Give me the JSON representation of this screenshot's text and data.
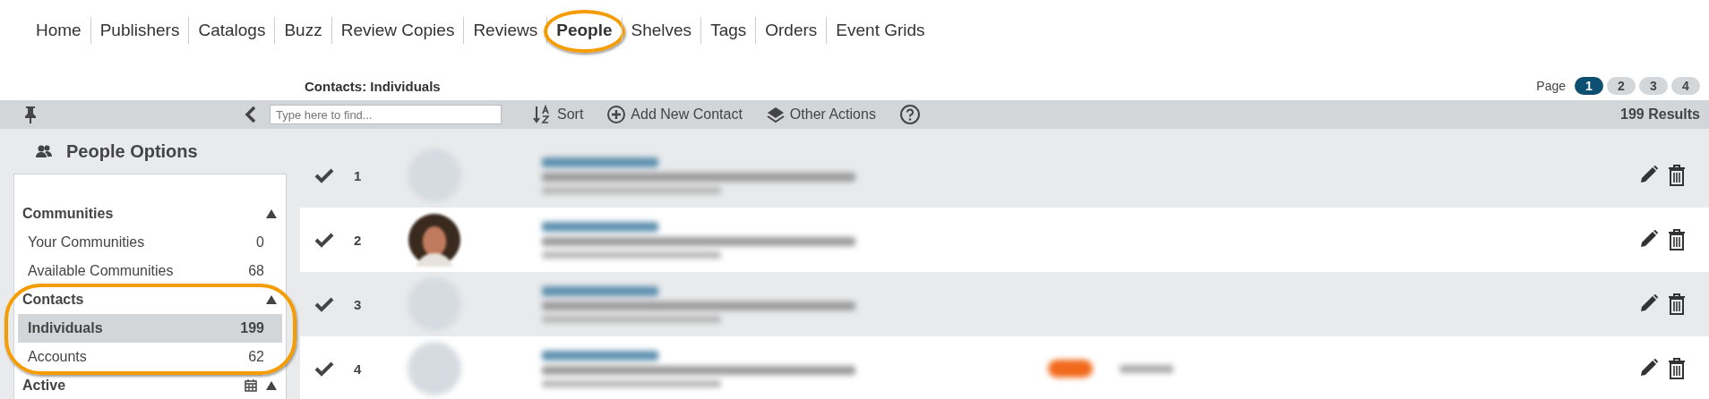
{
  "nav": [
    {
      "label": "Home",
      "selected": false,
      "highlighted": false
    },
    {
      "label": "Publishers",
      "selected": false,
      "highlighted": false
    },
    {
      "label": "Catalogs",
      "selected": false,
      "highlighted": false
    },
    {
      "label": "Buzz",
      "selected": false,
      "highlighted": false
    },
    {
      "label": "Review Copies",
      "selected": false,
      "highlighted": false
    },
    {
      "label": "Reviews",
      "selected": false,
      "highlighted": false
    },
    {
      "label": "People",
      "selected": true,
      "highlighted": true
    },
    {
      "label": "Shelves",
      "selected": false,
      "highlighted": false
    },
    {
      "label": "Tags",
      "selected": false,
      "highlighted": false
    },
    {
      "label": "Orders",
      "selected": false,
      "highlighted": false
    },
    {
      "label": "Event Grids",
      "selected": false,
      "highlighted": false
    }
  ],
  "page_title": "Contacts: Individuals",
  "pagination": {
    "label": "Page",
    "pages": [
      {
        "label": "1",
        "selected": true
      },
      {
        "label": "2",
        "selected": false
      },
      {
        "label": "3",
        "selected": false
      },
      {
        "label": "4",
        "selected": false
      }
    ]
  },
  "toolbar": {
    "search": {
      "placeholder": "Type here to find..."
    },
    "actions": [
      {
        "kind": "sort",
        "label": "Sort"
      },
      {
        "kind": "add",
        "label": "Add New Contact"
      },
      {
        "kind": "other",
        "label": "Other Actions"
      },
      {
        "kind": "help"
      }
    ],
    "results": "199 Results"
  },
  "sidebar": {
    "title": "People Options",
    "sections": [
      {
        "title": "Communities",
        "expanded": true,
        "highlighted": false,
        "calendar": false,
        "items": [
          {
            "label": "Your Communities",
            "count": "0",
            "selected": false
          },
          {
            "label": "Available Communities",
            "count": "68",
            "selected": false
          }
        ]
      },
      {
        "title": "Contacts",
        "expanded": true,
        "highlighted": true,
        "calendar": false,
        "items": [
          {
            "label": "Individuals",
            "count": "199",
            "selected": true
          },
          {
            "label": "Accounts",
            "count": "62",
            "selected": false
          }
        ]
      },
      {
        "title": "Active",
        "expanded": true,
        "highlighted": false,
        "calendar": true
      }
    ]
  },
  "rows": [
    {
      "number": "1",
      "checked": true,
      "photo": false,
      "tag": false
    },
    {
      "number": "2",
      "checked": true,
      "photo": true,
      "tag": false
    },
    {
      "number": "3",
      "checked": true,
      "photo": false,
      "tag": false
    },
    {
      "number": "4",
      "checked": true,
      "photo": false,
      "tag": true
    }
  ]
}
